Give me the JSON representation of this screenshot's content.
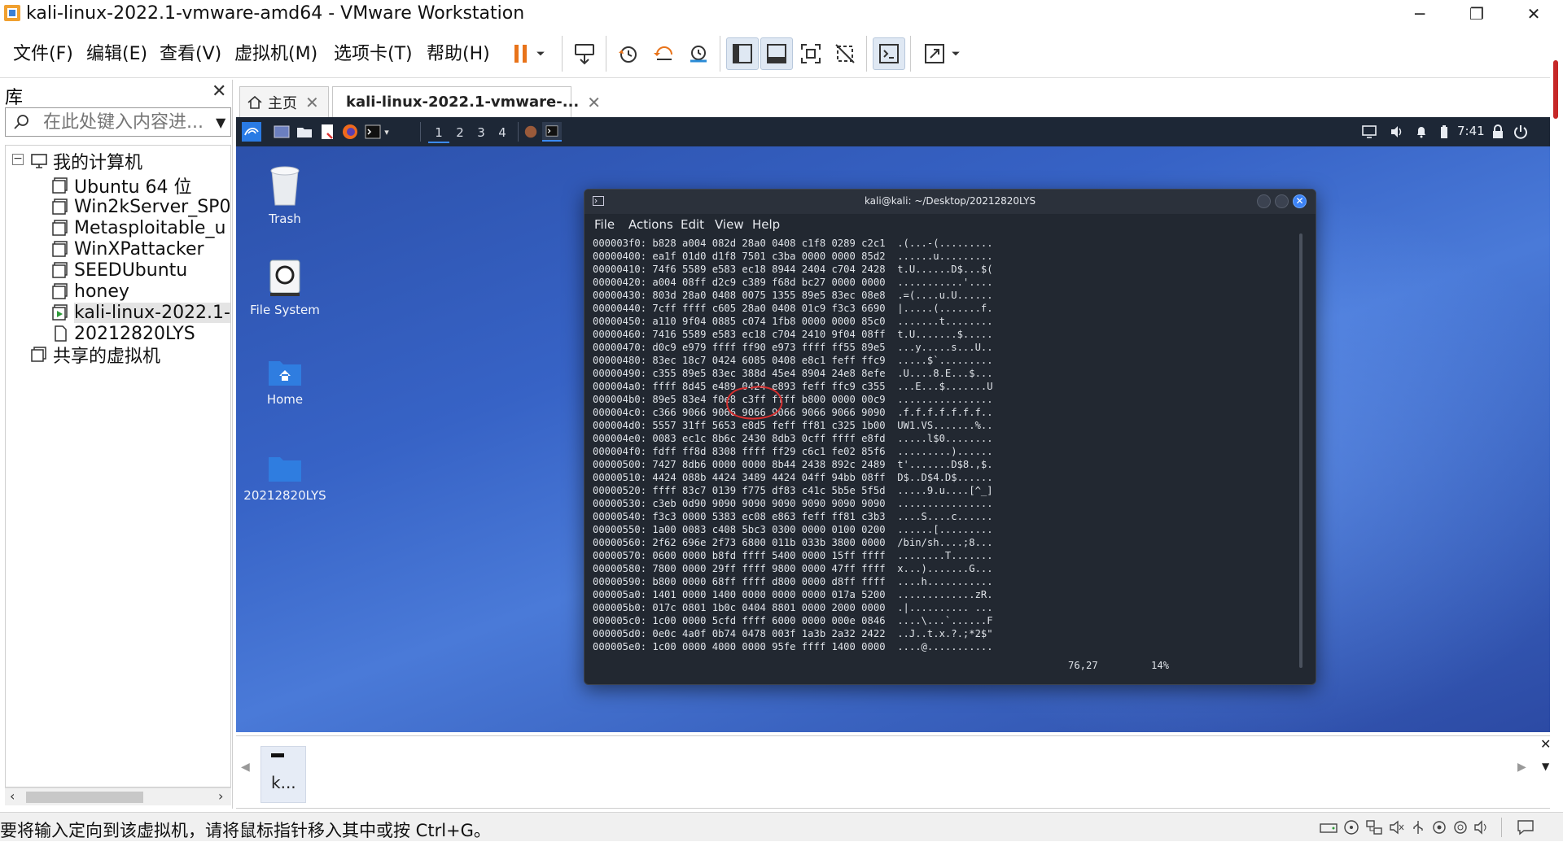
{
  "window": {
    "title": "kali-linux-2022.1-vmware-amd64 - VMware Workstation",
    "minimize": "─",
    "restore": "❐",
    "close": "✕"
  },
  "menu": {
    "file": "文件(F)",
    "edit": "编辑(E)",
    "view": "查看(V)",
    "vm": "虚拟机(M)",
    "tabs": "选项卡(T)",
    "help": "帮助(H)"
  },
  "library": {
    "header": "库",
    "close": "✕",
    "search_placeholder": "在此处键入内容进...",
    "tree": {
      "my_computer": "我的计算机",
      "vms": [
        "Ubuntu 64 位",
        "Win2kServer_SP0",
        "Metasploitable_u",
        "WinXPattacker",
        "SEEDUbuntu",
        "honey",
        "kali-linux-2022.1-",
        "20212820LYS"
      ],
      "shared": "共享的虚拟机"
    }
  },
  "tabs": [
    {
      "label": "主页"
    },
    {
      "label": "kali-linux-2022.1-vmware-..."
    }
  ],
  "kali": {
    "workspaces": [
      "1",
      "2",
      "3",
      "4"
    ],
    "clock": "7:41",
    "desktop_icons": [
      "Trash",
      "File System",
      "Home",
      "20212820LYS"
    ]
  },
  "terminal": {
    "title": "kali@kali: ~/Desktop/20212820LYS",
    "menu": [
      "File",
      "Actions",
      "Edit",
      "View",
      "Help"
    ],
    "lines": [
      "000003f0: b828 a004 082d 28a0 0408 c1f8 0289 c2c1  .(...-(.........",
      "00000400: ea1f 01d0 d1f8 7501 c3ba 0000 0000 85d2  ......u.........",
      "00000410: 74f6 5589 e583 ec18 8944 2404 c704 2428  t.U......D$...$(",
      "00000420: a004 08ff d2c9 c389 f68d bc27 0000 0000  ...........'....",
      "00000430: 803d 28a0 0408 0075 1355 89e5 83ec 08e8  .=(....u.U......",
      "00000440: 7cff ffff c605 28a0 0408 01c9 f3c3 6690  |.....(.......f.",
      "00000450: a110 9f04 0885 c074 1fb8 0000 0000 85c0  .......t........",
      "00000460: 7416 5589 e583 ec18 c704 2410 9f04 08ff  t.U.......$.....",
      "00000470: d0c9 e979 ffff ff90 e973 ffff ff55 89e5  ...y.....s...U..",
      "00000480: 83ec 18c7 0424 6085 0408 e8c1 feff ffc9  .....$`.........",
      "00000490: c355 89e5 83ec 388d 45e4 8904 24e8 8efe  .U....8.E...$...",
      "000004a0: ffff 8d45 e489 0424 e893 feff ffc9 c355  ...E...$.......U",
      "000004b0: 89e5 83e4 f0e8 c3ff ffff b800 0000 00c9  ................",
      "000004c0: c366 9066 9066 9066 9066 9066 9066 9090  .f.f.f.f.f.f.f..",
      "000004d0: 5557 31ff 5653 e8d5 feff ff81 c325 1b00  UW1.VS.......%..",
      "000004e0: 0083 ec1c 8b6c 2430 8db3 0cff ffff e8fd  .....l$0........",
      "000004f0: fdff ff8d 8308 ffff ff29 c6c1 fe02 85f6  .........)......",
      "00000500: 7427 8db6 0000 0000 8b44 2438 892c 2489  t'.......D$8.,$.",
      "00000510: 4424 088b 4424 3489 4424 04ff 94bb 08ff  D$..D$4.D$......",
      "00000520: ffff 83c7 0139 f775 df83 c41c 5b5e 5f5d  .....9.u....[^_]",
      "00000530: c3eb 0d90 9090 9090 9090 9090 9090 9090  ................",
      "00000540: f3c3 0000 5383 ec08 e863 feff ff81 c3b3  ....S....c......",
      "00000550: 1a00 0083 c408 5bc3 0300 0000 0100 0200  ......[.........",
      "00000560: 2f62 696e 2f73 6800 011b 033b 3800 0000  /bin/sh....;8...",
      "00000570: 0600 0000 b8fd ffff 5400 0000 15ff ffff  ........T.......",
      "00000580: 7800 0000 29ff ffff 9800 0000 47ff ffff  x...).......G...",
      "00000590: b800 0000 68ff ffff d800 0000 d8ff ffff  ....h...........",
      "000005a0: 1401 0000 1400 0000 0000 0000 017a 5200  .............zR.",
      "000005b0: 017c 0801 1b0c 0404 8801 0000 2000 0000  .|.......... ...",
      "000005c0: 1c00 0000 5cfd ffff 6000 0000 000e 0846  ....\\...`......F",
      "000005d0: 0e0c 4a0f 0b74 0478 003f 1a3b 2a32 2422  ..J..t.x.?.;*2$\"",
      "000005e0: 1c00 0000 4000 0000 95fe ffff 1400 0000  ....@..........."
    ],
    "cursor_pos": "76,27",
    "percent": "14%"
  },
  "thumbnail": {
    "label": "k..."
  },
  "statusbar": {
    "message": "要将输入定向到该虚拟机，请将鼠标指针移入其中或按 Ctrl+G。"
  },
  "colors": {
    "accent": "#3b82f6",
    "pause": "#e8731a",
    "annotation": "#d32f2f"
  }
}
